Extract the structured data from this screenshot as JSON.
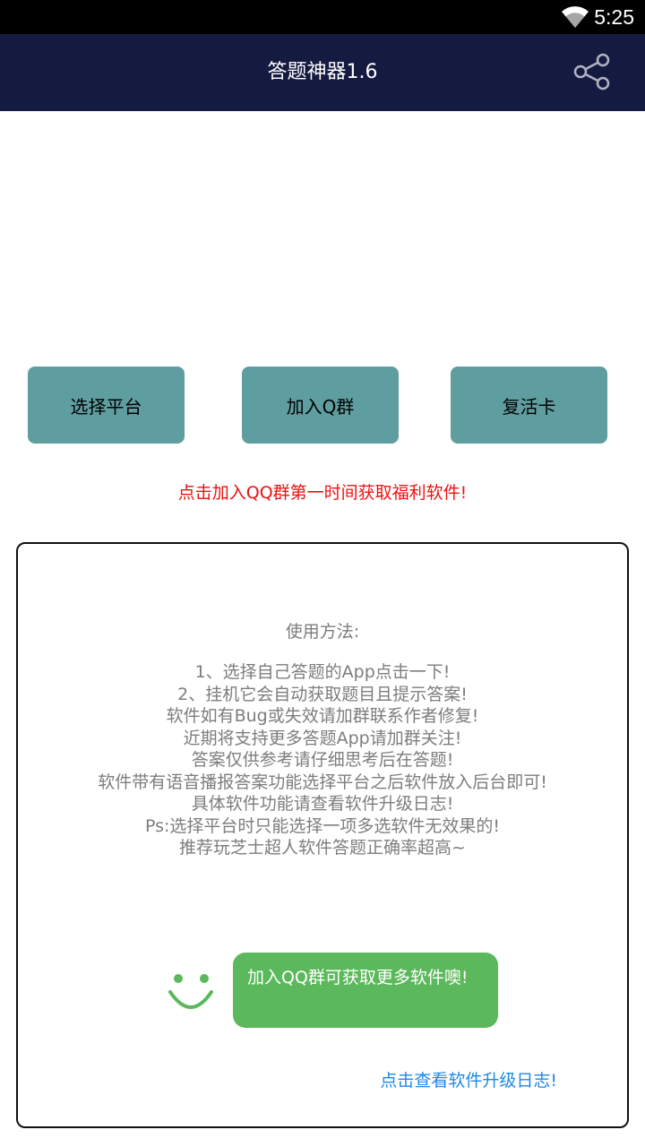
{
  "status_bar": {
    "time": "5:25",
    "wifi_icon": "wifi-icon"
  },
  "app_bar": {
    "title": "答题神器1.6",
    "share_icon": "share-icon"
  },
  "buttons": [
    {
      "label": "选择平台"
    },
    {
      "label": "加入Q群"
    },
    {
      "label": "复活卡"
    }
  ],
  "promo_text": "点击加入QQ群第一时间获取福利软件!",
  "instructions": {
    "title": "使用方法:",
    "lines": [
      "1、选择自己答题的App点击一下!",
      "2、挂机它会自动获取题目且提示答案!",
      "软件如有Bug或失效请加群联系作者修复!",
      "近期将支持更多答题App请加群关注!",
      "答案仅供参考请仔细思考后在答题!",
      "软件带有语音播报答案功能选择平台之后软件放入后台即可!",
      "具体软件功能请查看软件升级日志!",
      "Ps:选择平台时只能选择一项多选软件无效果的!",
      "推荐玩芝士超人软件答题正确率超高~"
    ]
  },
  "bubble_text": "加入QQ群可获取更多软件噢!",
  "log_link": "点击查看软件升级日志!",
  "colors": {
    "app_bar": "#151b40",
    "button": "#5f9ea0",
    "promo": "#ee1111",
    "bubble": "#5cb85c",
    "link": "#1e88e5"
  }
}
